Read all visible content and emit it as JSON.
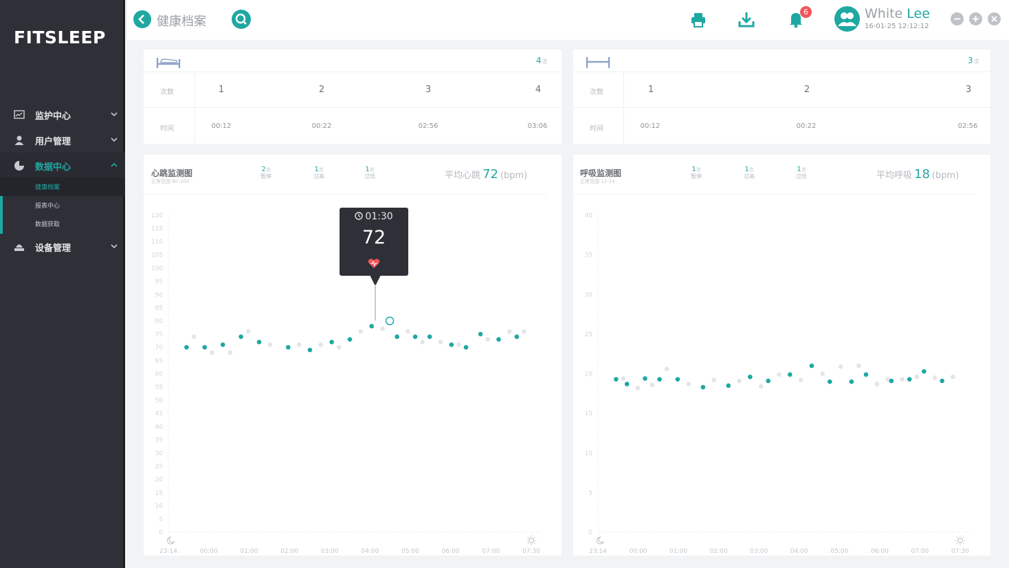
{
  "app": {
    "logo": "FITSLEEP"
  },
  "sidebar": {
    "items": [
      {
        "label": "监护中心",
        "icon": "monitor-icon",
        "expanded": false
      },
      {
        "label": "用户管理",
        "icon": "user-icon",
        "expanded": false
      },
      {
        "label": "数据中心",
        "icon": "pie-chart-icon",
        "expanded": true,
        "active": true
      },
      {
        "label": "设备管理",
        "icon": "device-icon",
        "expanded": false
      }
    ],
    "subitems": [
      {
        "label": "健康档案",
        "active": true
      },
      {
        "label": "报表中心",
        "active": false
      },
      {
        "label": "数据获取",
        "active": false
      }
    ]
  },
  "header": {
    "title": "健康档案",
    "notification_count": "6",
    "user_first": "White",
    "user_last": "Lee",
    "user_time": "16-01-25 12:12:12"
  },
  "bed_card": {
    "count": "4",
    "count_unit": "次",
    "row1_label": "次数",
    "row2_label": "时间",
    "numbers": [
      "1",
      "2",
      "3",
      "4"
    ],
    "times": [
      "00:12",
      "00:22",
      "02:56",
      "03:06"
    ]
  },
  "body_card": {
    "count": "3",
    "count_unit": "次",
    "row1_label": "次数",
    "row2_label": "时间",
    "numbers": [
      "1",
      "2",
      "3"
    ],
    "times": [
      "00:12",
      "00:22",
      "02:56"
    ]
  },
  "heart_panel": {
    "title": "心跳监测图",
    "subtitle": "正常范围 60-100",
    "stats": [
      {
        "num": "2",
        "unit": "次",
        "label": "暂停"
      },
      {
        "num": "1",
        "unit": "次",
        "label": "过高"
      },
      {
        "num": "1",
        "unit": "次",
        "label": "过低"
      }
    ],
    "avg_label": "平均心跳",
    "avg_value": "72",
    "avg_unit": "(bpm)",
    "tooltip_time": "01:30",
    "tooltip_value": "72"
  },
  "breath_panel": {
    "title": "呼吸监测图",
    "subtitle": "正常范围 12-24",
    "stats": [
      {
        "num": "1",
        "unit": "次",
        "label": "暂停"
      },
      {
        "num": "1",
        "unit": "次",
        "label": "过高"
      },
      {
        "num": "1",
        "unit": "次",
        "label": "过低"
      }
    ],
    "avg_label": "平均呼吸",
    "avg_value": "18",
    "avg_unit": "(bpm)"
  },
  "colors": {
    "accent": "#1fa8a2",
    "sidebar": "#2f3037",
    "badge": "#f2535b",
    "faded_point": "#e3e5e7"
  },
  "chart_data": [
    {
      "type": "scatter",
      "name": "heart",
      "ylim": [
        0,
        120
      ],
      "y_ticks": [
        "0",
        "5",
        "10",
        "15",
        "20",
        "25",
        "30",
        "35",
        "40",
        "45",
        "50",
        "55",
        "60",
        "65",
        "70",
        "75",
        "80",
        "85",
        "90",
        "95",
        "100",
        "105",
        "110",
        "115",
        "120"
      ],
      "x_ticks": [
        "23:14",
        "00:00",
        "01:00",
        "02:00",
        "03:00",
        "04:00",
        "05:00",
        "06:00",
        "07:00",
        "07:30"
      ],
      "points_primary": [
        [
          0.05,
          70
        ],
        [
          0.1,
          70
        ],
        [
          0.15,
          71
        ],
        [
          0.2,
          74
        ],
        [
          0.25,
          72
        ],
        [
          0.33,
          70
        ],
        [
          0.39,
          69
        ],
        [
          0.45,
          72
        ],
        [
          0.5,
          73
        ],
        [
          0.56,
          78
        ],
        [
          0.63,
          74
        ],
        [
          0.68,
          74
        ],
        [
          0.72,
          74
        ],
        [
          0.78,
          71
        ],
        [
          0.82,
          70
        ],
        [
          0.86,
          75
        ],
        [
          0.91,
          73
        ],
        [
          0.96,
          74
        ]
      ],
      "points_faded": [
        [
          0.07,
          74
        ],
        [
          0.12,
          68
        ],
        [
          0.17,
          68
        ],
        [
          0.22,
          76
        ],
        [
          0.28,
          71
        ],
        [
          0.36,
          71
        ],
        [
          0.42,
          71
        ],
        [
          0.47,
          70
        ],
        [
          0.53,
          76
        ],
        [
          0.59,
          77
        ],
        [
          0.66,
          76
        ],
        [
          0.7,
          72
        ],
        [
          0.75,
          72
        ],
        [
          0.8,
          71
        ],
        [
          0.88,
          73
        ],
        [
          0.94,
          76
        ],
        [
          0.98,
          76
        ]
      ],
      "highlight": [
        0.61,
        80
      ]
    },
    {
      "type": "scatter",
      "name": "breath",
      "ylim": [
        0,
        40
      ],
      "y_ticks": [
        "0",
        "5",
        "10",
        "15",
        "20",
        "25",
        "30",
        "35",
        "40"
      ],
      "x_ticks": [
        "23:14",
        "00:00",
        "01:00",
        "02:00",
        "03:00",
        "04:00",
        "05:00",
        "06:00",
        "07:00",
        "07:30"
      ],
      "points_primary": [
        [
          0.05,
          19.3
        ],
        [
          0.08,
          18.7
        ],
        [
          0.13,
          19.4
        ],
        [
          0.17,
          19.3
        ],
        [
          0.22,
          19.3
        ],
        [
          0.29,
          18.3
        ],
        [
          0.36,
          18.5
        ],
        [
          0.42,
          19.6
        ],
        [
          0.47,
          19.1
        ],
        [
          0.53,
          19.9
        ],
        [
          0.59,
          21
        ],
        [
          0.64,
          19
        ],
        [
          0.7,
          19
        ],
        [
          0.74,
          19.9
        ],
        [
          0.81,
          19.1
        ],
        [
          0.86,
          19.3
        ],
        [
          0.9,
          20.3
        ],
        [
          0.95,
          19.1
        ]
      ],
      "points_faded": [
        [
          0.07,
          19.4
        ],
        [
          0.11,
          18.2
        ],
        [
          0.15,
          18.6
        ],
        [
          0.19,
          20.6
        ],
        [
          0.25,
          18.7
        ],
        [
          0.32,
          19.2
        ],
        [
          0.39,
          19.1
        ],
        [
          0.45,
          18.4
        ],
        [
          0.5,
          19.9
        ],
        [
          0.56,
          19.2
        ],
        [
          0.62,
          20
        ],
        [
          0.67,
          20.9
        ],
        [
          0.72,
          21
        ],
        [
          0.77,
          18.7
        ],
        [
          0.8,
          19.3
        ],
        [
          0.84,
          19.3
        ],
        [
          0.88,
          19.6
        ],
        [
          0.93,
          19.5
        ],
        [
          0.98,
          19.6
        ]
      ]
    }
  ]
}
